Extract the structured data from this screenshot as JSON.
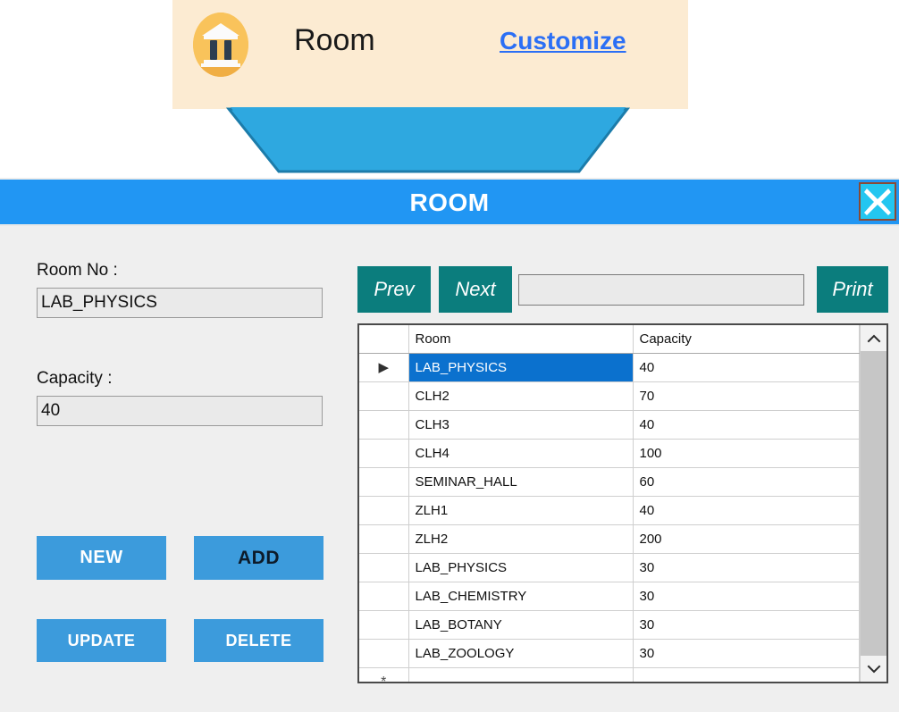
{
  "banner": {
    "icon": "bank-building-icon",
    "title": "Room",
    "link_label": "Customize",
    "background_color": "#FCEBD2",
    "icon_circle_color": "#F9C35B",
    "link_color": "#2B6FF5"
  },
  "arrow": {
    "name": "down-arrow-connector",
    "color": "#2EA8E0"
  },
  "window": {
    "title": "ROOM",
    "titlebar_color": "#2196F3",
    "close_label": "X",
    "body_color": "#EFEFEF"
  },
  "form": {
    "room_no": {
      "label": "Room No :",
      "value": "LAB_PHYSICS",
      "placeholder": ""
    },
    "capacity": {
      "label": "Capacity :",
      "value": "40",
      "placeholder": ""
    }
  },
  "actions": {
    "new_label": "NEW",
    "add_label": "ADD",
    "update_label": "UPDATE",
    "delete_label": "DELETE",
    "button_color": "#3C9BDC"
  },
  "toolbar": {
    "prev_label": "Prev",
    "next_label": "Next",
    "print_label": "Print",
    "button_color": "#0B7D7D",
    "search": {
      "value": "",
      "placeholder": ""
    }
  },
  "grid": {
    "columns": [
      "",
      "Room",
      "Capacity"
    ],
    "selection_color": "#0B71CE",
    "row_marker": "▶",
    "new_row_marker": "*",
    "selected_index": 0,
    "rows": [
      {
        "marker": "▶",
        "room": "LAB_PHYSICS",
        "capacity": "40",
        "selected": true
      },
      {
        "marker": "",
        "room": "CLH2",
        "capacity": "70",
        "selected": false
      },
      {
        "marker": "",
        "room": "CLH3",
        "capacity": "40",
        "selected": false
      },
      {
        "marker": "",
        "room": "CLH4",
        "capacity": "100",
        "selected": false
      },
      {
        "marker": "",
        "room": "SEMINAR_HALL",
        "capacity": "60",
        "selected": false
      },
      {
        "marker": "",
        "room": "ZLH1",
        "capacity": "40",
        "selected": false
      },
      {
        "marker": "",
        "room": "ZLH2",
        "capacity": "200",
        "selected": false
      },
      {
        "marker": "",
        "room": "LAB_PHYSICS",
        "capacity": "30",
        "selected": false
      },
      {
        "marker": "",
        "room": "LAB_CHEMISTRY",
        "capacity": "30",
        "selected": false
      },
      {
        "marker": "",
        "room": "LAB_BOTANY",
        "capacity": "30",
        "selected": false
      },
      {
        "marker": "",
        "room": "LAB_ZOOLOGY",
        "capacity": "30",
        "selected": false
      },
      {
        "marker": "*",
        "room": "",
        "capacity": "",
        "selected": false
      }
    ],
    "scrollbar": {
      "up_icon": "chevron-up-icon",
      "down_icon": "chevron-down-icon"
    }
  }
}
